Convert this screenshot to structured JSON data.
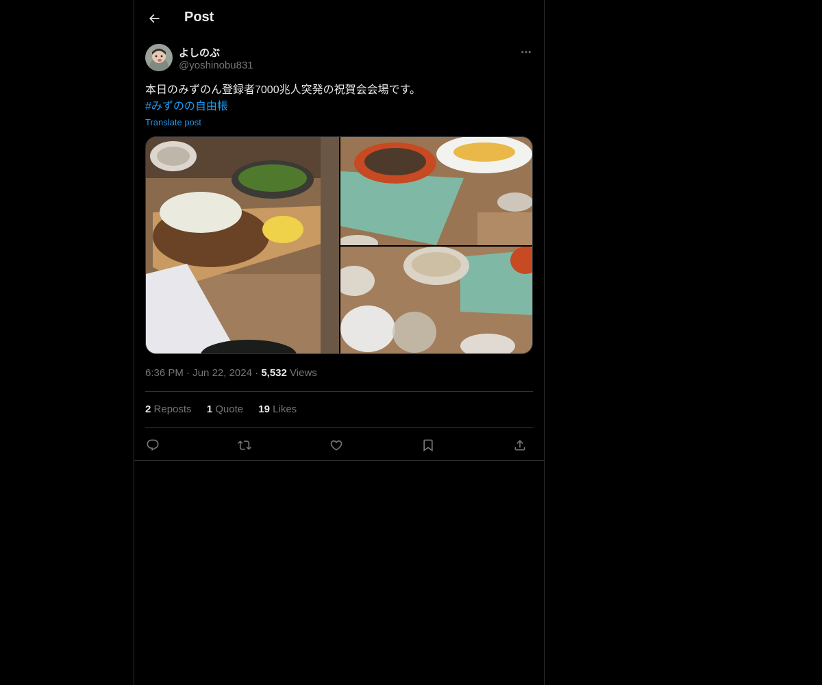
{
  "header": {
    "title": "Post",
    "back_icon": "arrow-left-icon"
  },
  "post": {
    "author": {
      "display_name": "よしのぶ",
      "handle": "@yoshinobu831"
    },
    "text": "本日のみずのん登録者7000兆人突発の祝賀会会場です。",
    "hashtag": "#みずのの自由帳",
    "translate_label": "Translate post",
    "time": "6:36 PM",
    "separator": "·",
    "date": "Jun 22, 2024",
    "views_count": "5,532",
    "views_label": "Views",
    "stats": {
      "reposts_count": "2",
      "reposts_label": "Reposts",
      "quotes_count": "1",
      "quotes_label": "Quote",
      "likes_count": "19",
      "likes_label": "Likes"
    },
    "actions": [
      "reply-icon",
      "repost-icon",
      "like-icon",
      "bookmark-icon",
      "share-icon"
    ]
  },
  "colors": {
    "background": "#000000",
    "text_primary": "#e7e9ea",
    "text_secondary": "#71767b",
    "accent": "#1d9bf0",
    "border": "#2f3336"
  }
}
